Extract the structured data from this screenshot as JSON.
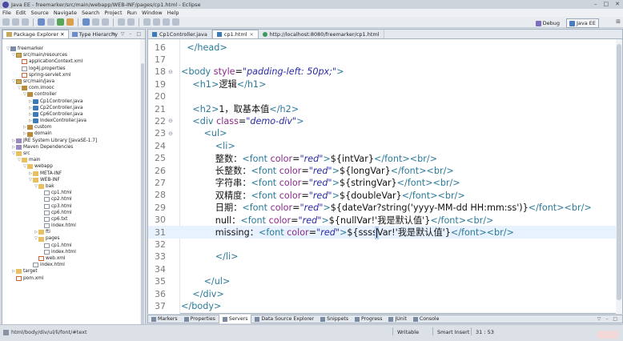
{
  "window": {
    "title": "Java EE - freemarker/src/main/webapp/WEB-INF/pages/cp1.html - Eclipse",
    "controls": [
      "–",
      "□",
      "✕"
    ]
  },
  "menu": [
    "File",
    "Edit",
    "Source",
    "Navigate",
    "Search",
    "Project",
    "Run",
    "Window",
    "Help"
  ],
  "perspectives": [
    {
      "label": "Debug",
      "active": false
    },
    {
      "label": "Java EE",
      "active": true
    }
  ],
  "left_panel": {
    "tabs": [
      {
        "label": "Package Explorer",
        "active": true
      },
      {
        "label": "Type Hierarchy",
        "active": false
      }
    ],
    "tree": [
      {
        "label": "freemarker",
        "indent": 0,
        "toggle": "▽",
        "icon": "proj"
      },
      {
        "label": "src/main/resources",
        "indent": 1,
        "toggle": "▽",
        "icon": "src"
      },
      {
        "label": "applicationContext.xml",
        "indent": 2,
        "toggle": "",
        "icon": "xml"
      },
      {
        "label": "log4j.properties",
        "indent": 2,
        "toggle": "",
        "icon": "file"
      },
      {
        "label": "spring-servlet.xml",
        "indent": 2,
        "toggle": "",
        "icon": "xml"
      },
      {
        "label": "src/main/java",
        "indent": 1,
        "toggle": "▽",
        "icon": "src"
      },
      {
        "label": "com.imooc",
        "indent": 2,
        "toggle": "▽",
        "icon": "pkg"
      },
      {
        "label": "controller",
        "indent": 3,
        "toggle": "▽",
        "icon": "pkg"
      },
      {
        "label": "Cp1Controller.java",
        "indent": 4,
        "toggle": "▷",
        "icon": "java"
      },
      {
        "label": "Cp2Controller.java",
        "indent": 4,
        "toggle": "▷",
        "icon": "java"
      },
      {
        "label": "Cp6Controller.java",
        "indent": 4,
        "toggle": "▷",
        "icon": "java"
      },
      {
        "label": "IndexController.java",
        "indent": 4,
        "toggle": "▷",
        "icon": "java"
      },
      {
        "label": "custom",
        "indent": 3,
        "toggle": "▷",
        "icon": "pkg"
      },
      {
        "label": "domain",
        "indent": 3,
        "toggle": "▷",
        "icon": "pkg"
      },
      {
        "label": "JRE System Library [JavaSE-1.7]",
        "indent": 1,
        "toggle": "▷",
        "icon": "lib"
      },
      {
        "label": "Maven Dependencies",
        "indent": 1,
        "toggle": "▷",
        "icon": "lib"
      },
      {
        "label": "src",
        "indent": 1,
        "toggle": "▽",
        "icon": "folder"
      },
      {
        "label": "main",
        "indent": 2,
        "toggle": "▽",
        "icon": "folder"
      },
      {
        "label": "webapp",
        "indent": 3,
        "toggle": "▽",
        "icon": "folder"
      },
      {
        "label": "META-INF",
        "indent": 4,
        "toggle": "▷",
        "icon": "folder"
      },
      {
        "label": "WEB-INF",
        "indent": 4,
        "toggle": "▽",
        "icon": "folder"
      },
      {
        "label": "bak",
        "indent": 5,
        "toggle": "▽",
        "icon": "folder"
      },
      {
        "label": "cp1.html",
        "indent": 6,
        "toggle": "",
        "icon": "file"
      },
      {
        "label": "cp2.html",
        "indent": 6,
        "toggle": "",
        "icon": "file"
      },
      {
        "label": "cp3.html",
        "indent": 6,
        "toggle": "",
        "icon": "file"
      },
      {
        "label": "cp6.html",
        "indent": 6,
        "toggle": "",
        "icon": "file"
      },
      {
        "label": "cp6.txt",
        "indent": 6,
        "toggle": "",
        "icon": "file"
      },
      {
        "label": "index.html",
        "indent": 6,
        "toggle": "",
        "icon": "file"
      },
      {
        "label": "ftl",
        "indent": 5,
        "toggle": "▷",
        "icon": "folder"
      },
      {
        "label": "pages",
        "indent": 5,
        "toggle": "▽",
        "icon": "folder"
      },
      {
        "label": "cp1.html",
        "indent": 6,
        "toggle": "",
        "icon": "file"
      },
      {
        "label": "index.html",
        "indent": 6,
        "toggle": "",
        "icon": "file"
      },
      {
        "label": "web.xml",
        "indent": 5,
        "toggle": "",
        "icon": "xml"
      },
      {
        "label": "index.html",
        "indent": 4,
        "toggle": "",
        "icon": "file"
      },
      {
        "label": "target",
        "indent": 1,
        "toggle": "▷",
        "icon": "folder"
      },
      {
        "label": "pom.xml",
        "indent": 1,
        "toggle": "",
        "icon": "xml"
      }
    ]
  },
  "editor": {
    "tabs": [
      {
        "label": "Cp1Controller.java",
        "active": false,
        "icon": "java"
      },
      {
        "label": "cp1.html",
        "active": true,
        "icon": "java"
      },
      {
        "label": "http://localhost:8080/freemarker/cp1.html",
        "active": false,
        "icon": "web"
      }
    ],
    "lines": [
      {
        "n": "16",
        "fold": "",
        "text": "    </head>"
      },
      {
        "n": "17",
        "fold": "",
        "text": ""
      },
      {
        "n": "18",
        "fold": "⊖",
        "text": "  <body style=\"padding-left: 50px;\">"
      },
      {
        "n": "19",
        "fold": "",
        "text": "      <h1>逻辑</h1>"
      },
      {
        "n": "20",
        "fold": "",
        "text": ""
      },
      {
        "n": "21",
        "fold": "",
        "text": "      <h2>1，取基本值</h2>"
      },
      {
        "n": "22",
        "fold": "⊖",
        "text": "      <div class=\"demo-div\">"
      },
      {
        "n": "23",
        "fold": "⊖",
        "text": "          <ul>"
      },
      {
        "n": "24",
        "fold": "",
        "text": "              <li>"
      },
      {
        "n": "25",
        "fold": "",
        "text": "              整数：<font color=\"red\">${intVar}</font><br/>"
      },
      {
        "n": "26",
        "fold": "",
        "text": "              长整数：<font color=\"red\">${longVar}</font><br/>"
      },
      {
        "n": "27",
        "fold": "",
        "text": "              字符串：<font color=\"red\">${stringVar}</font><br/>"
      },
      {
        "n": "28",
        "fold": "",
        "text": "              双精度：<font color=\"red\">${doubleVar}</font><br/>"
      },
      {
        "n": "29",
        "fold": "",
        "text": "              日期：<font color=\"red\">${dateVar?string('yyyy-MM-dd HH:mm:ss')}</font><br/>"
      },
      {
        "n": "30",
        "fold": "",
        "text": "              null：<font color=\"red\">${nullVar!'我是默认值'}</font><br/>"
      },
      {
        "n": "31",
        "fold": "",
        "text": "              missing：<font color=\"red\">${ssssVar!'我是默认值'}</font><br/>"
      },
      {
        "n": "32",
        "fold": "",
        "text": ""
      },
      {
        "n": "33",
        "fold": "",
        "text": "              </li>"
      },
      {
        "n": "34",
        "fold": "",
        "text": ""
      },
      {
        "n": "35",
        "fold": "",
        "text": "          </ul>"
      },
      {
        "n": "36",
        "fold": "",
        "text": "      </div>"
      },
      {
        "n": "37",
        "fold": "",
        "text": "  </body>"
      }
    ],
    "current_line": "31"
  },
  "bottom_tabs": [
    {
      "label": "Markers",
      "active": false
    },
    {
      "label": "Properties",
      "active": false
    },
    {
      "label": "Servers",
      "active": true
    },
    {
      "label": "Data Source Explorer",
      "active": false
    },
    {
      "label": "Snippets",
      "active": false
    },
    {
      "label": "Progress",
      "active": false
    },
    {
      "label": "JUnit",
      "active": false
    },
    {
      "label": "Console",
      "active": false
    }
  ],
  "status": {
    "path": "html/body/div/ul/li/font/#text",
    "writable": "Writable",
    "insert_mode": "Smart Insert",
    "position": "31 : 53"
  }
}
